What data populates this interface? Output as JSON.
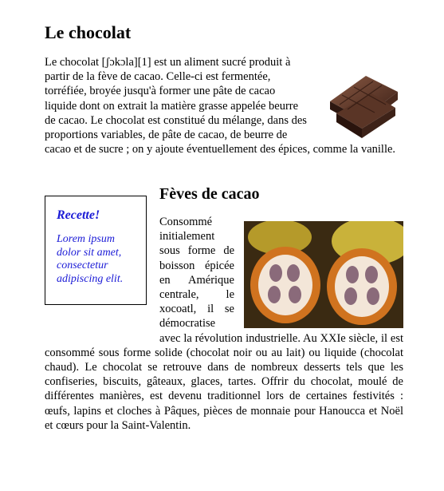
{
  "title": "Le chocolat",
  "intro_text": "Le chocolat [ʃɔkɔla][1] est un aliment sucré produit à partir de la fève de cacao. Celle-ci est fermentée, torréfiée, broyée jusqu'à former une pâte de cacao liquide dont on extrait la matière grasse appelée beurre de cacao. Le chocolat est constitué du mélange, dans des proportions variables, de pâte de cacao, de beurre de cacao et de sucre ; on y ajoute éventuellement des épices, comme la vanille.",
  "section_title": "Fèves de cacao",
  "section_text": "Consommé initialement sous forme de boisson épicée en Amérique centrale, le xocoatl, il se démocratise avec la révolution industrielle. Au XXIe siècle, il est consommé sous forme solide (chocolat noir ou au lait) ou liquide (chocolat chaud). Le chocolat se retrouve dans de nombreux desserts tels que les confiseries, biscuits, gâteaux, glaces, tartes. Offrir du chocolat, moulé de différentes manières, est devenu traditionnel lors de certaines festivités : œufs, lapins et cloches à Pâques, pièces de monnaie pour Hanoucca et Noël et cœurs pour la Saint-Valentin.",
  "recipe": {
    "title": "Recette!",
    "body": "Lorem ipsum dolor sit amet, consectetur adipiscing elit."
  },
  "colors": {
    "recipe_text": "#1a1ad6"
  },
  "images": {
    "chocolate": "chocolate-bar-photo",
    "cacao": "cacao-pods-photo"
  }
}
